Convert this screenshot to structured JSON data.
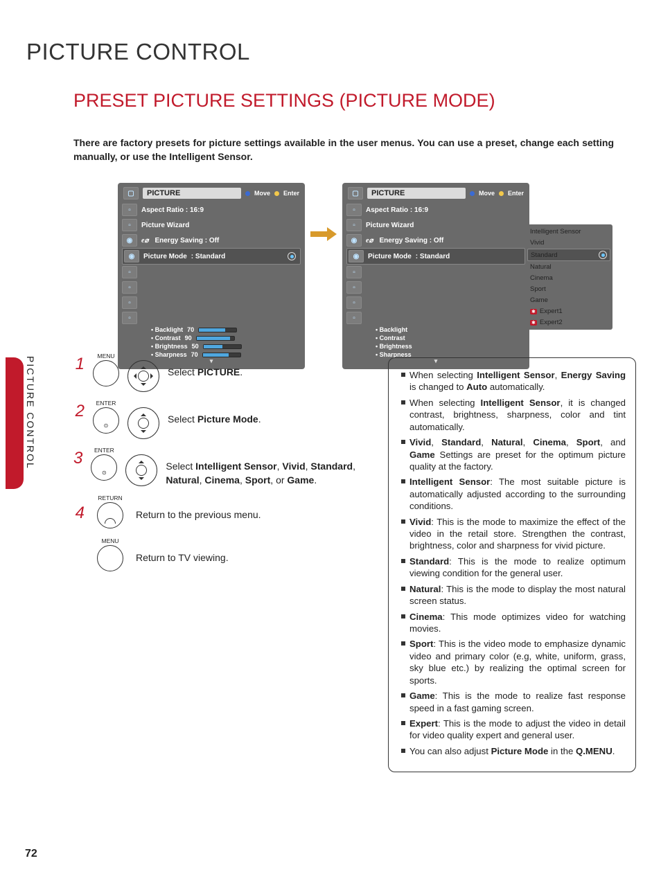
{
  "title": "PICTURE CONTROL",
  "subtitle": "PRESET PICTURE SETTINGS (PICTURE MODE)",
  "intro": "There are factory presets for picture settings available in the user menus. You can use a preset, change each setting manually, or use the Intelligent Sensor.",
  "side_label": "PICTURE CONTROL",
  "page_number": "72",
  "osd": {
    "title": "PICTURE",
    "hints": {
      "move": "Move",
      "enter": "Enter"
    },
    "items": {
      "aspect": "Aspect Ratio   : 16:9",
      "wizard": "Picture Wizard",
      "energy": "Energy Saving : Off",
      "mode_label": "Picture Mode",
      "mode_value": ": Standard"
    },
    "sliders": [
      {
        "label": "• Backlight",
        "value": "70",
        "fill": 70
      },
      {
        "label": "• Contrast",
        "value": "90",
        "fill": 90
      },
      {
        "label": "• Brightness",
        "value": "50",
        "fill": 50
      },
      {
        "label": "• Sharpness",
        "value": "70",
        "fill": 70
      }
    ],
    "popup": [
      "Intelligent Sensor",
      "Vivid",
      "Standard",
      "Natural",
      "Cinema",
      "Sport",
      "Game",
      "Expert1",
      "Expert2"
    ]
  },
  "steps": {
    "s1": {
      "btn": "MENU",
      "text_pre": "Select ",
      "bold": "PICTURE",
      "text_post": "."
    },
    "s2": {
      "btn": "ENTER",
      "text_pre": "Select ",
      "bold": "Picture Mode",
      "text_post": "."
    },
    "s3": {
      "btn": "ENTER",
      "text": "Select Intelligent Sensor, Vivid, Standard, Natural, Cinema, Sport, or Game."
    },
    "s4": {
      "btn": "RETURN",
      "text": "Return to the previous menu."
    },
    "s5": {
      "btn": "MENU",
      "text": "Return to TV viewing."
    }
  },
  "info": {
    "items": [
      "When selecting Intelligent Sensor, Energy Saving is changed to Auto automatically.",
      "When selecting Intelligent Sensor, it is changed contrast, brightness, sharpness, color and tint automatically.",
      "Vivid, Standard, Natural, Cinema, Sport, and Game Settings are preset for the optimum picture quality at the factory.",
      "Intelligent Sensor: The most suitable picture is automatically adjusted according to the surrounding conditions.",
      "Vivid: This is the mode to maximize the effect of the video in the retail store. Strengthen the contrast, brightness, color and sharpness for vivid picture.",
      "Standard: This is the mode to realize optimum viewing condition for the general user.",
      "Natural: This is the mode to display the most natural screen status.",
      "Cinema: This mode optimizes video for watching movies.",
      "Sport: This is the video mode to emphasize dynamic video and primary color (e.g, white, uniform, grass, sky blue etc.) by realizing the optimal screen for sports.",
      "Game: This is the mode to realize fast response speed in a fast gaming screen.",
      "Expert: This is the mode to adjust the video in detail for video quality expert and general user.",
      "You can also adjust Picture Mode in the Q.MENU."
    ]
  }
}
